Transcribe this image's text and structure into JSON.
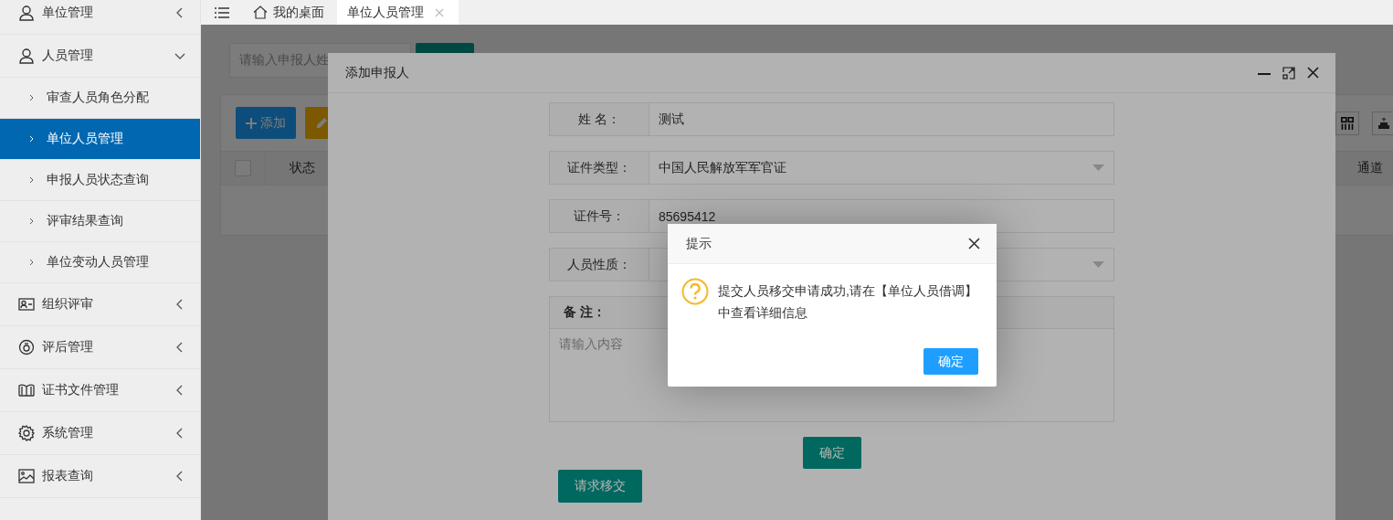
{
  "sidebar": {
    "items": [
      {
        "label": "单位管理",
        "expanded": false
      },
      {
        "label": "人员管理",
        "expanded": true,
        "children": [
          {
            "label": "审查人员角色分配",
            "selected": false
          },
          {
            "label": "单位人员管理",
            "selected": true
          },
          {
            "label": "申报人员状态查询",
            "selected": false
          },
          {
            "label": "评审结果查询",
            "selected": false
          },
          {
            "label": "单位变动人员管理",
            "selected": false
          }
        ]
      },
      {
        "label": "组织评审",
        "expanded": false
      },
      {
        "label": "评后管理",
        "expanded": false
      },
      {
        "label": "证书文件管理",
        "expanded": false
      },
      {
        "label": "系统管理",
        "expanded": false
      },
      {
        "label": "报表查询",
        "expanded": false
      }
    ]
  },
  "tabs": [
    {
      "label": "我的桌面",
      "selected": false
    },
    {
      "label": "单位人员管理",
      "selected": true
    }
  ],
  "page": {
    "search": {
      "placeholder": "请输入申报人姓"
    },
    "add_button": "添加",
    "table": {
      "select_all": {
        "checked": false
      },
      "columns": [
        "状态",
        "通道"
      ]
    }
  },
  "modal": {
    "title": "添加申报人",
    "fields": [
      {
        "kind": "input",
        "label": "姓 名：",
        "value": "测试"
      },
      {
        "kind": "select",
        "label": "证件类型：",
        "value": "中国人民解放军军官证"
      },
      {
        "kind": "input",
        "label": "证件号：",
        "value": "85695412"
      },
      {
        "kind": "select",
        "label": "人员性质："
      }
    ],
    "remark": {
      "label": "备 注：",
      "placeholder": "请输入内容"
    },
    "confirm_button": "确定",
    "transfer_button": "请求移交"
  },
  "alert": {
    "title": "提示",
    "message": "提交人员移交申请成功,请在【单位人员借调】中查看详细信息",
    "button": "确定"
  }
}
